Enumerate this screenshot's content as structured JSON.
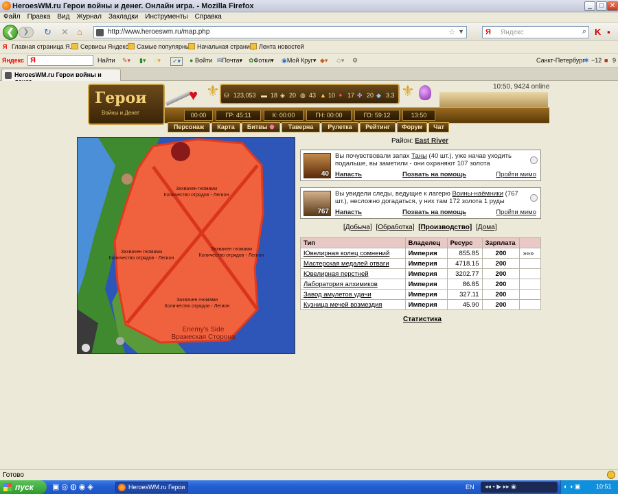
{
  "window": {
    "title": "HeroesWM.ru Герои войны и денег. Онлайн игра. - Mozilla Firefox",
    "min": "_",
    "max": "□",
    "close": "✕"
  },
  "menu": [
    "Файл",
    "Правка",
    "Вид",
    "Журнал",
    "Закладки",
    "Инструменты",
    "Справка"
  ],
  "nav": {
    "url": "http://www.heroeswm.ru/map.php",
    "search_logo": "Я",
    "search_placeholder": "Яндекс"
  },
  "bookmarks": [
    "Главная страница Я...",
    "Сервисы Яндекса",
    "Самые популярные",
    "Начальная страница",
    "Лента новостей"
  ],
  "yabar": {
    "logo": "Яндекс",
    "input": "Я",
    "find": "Найти",
    "login": "Войти",
    "mail": "Почта",
    "photos": "Фотки",
    "mycircle": "Мой Круг",
    "city": "Санкт-Петербург",
    "temp": "−12",
    "count": "9"
  },
  "tab": {
    "title": "HeroesWM.ru Герои войны и денег. ..."
  },
  "game": {
    "logo_top": "Герои",
    "logo_sub": "Войны и Денег",
    "online": "10:50, 9424 online",
    "resources": [
      {
        "icon": "gold-icon",
        "value": "123,053"
      },
      {
        "icon": "wood-icon",
        "value": "18"
      },
      {
        "icon": "ore-icon",
        "value": "20"
      },
      {
        "icon": "mercury-icon",
        "value": "43"
      },
      {
        "icon": "sulfur-icon",
        "value": "10"
      },
      {
        "icon": "crystal-icon",
        "value": "17"
      },
      {
        "icon": "gem-icon",
        "value": "20"
      },
      {
        "icon": "diamond-icon",
        "value": "3.3"
      }
    ],
    "timers": [
      "00:00",
      "ГР: 45:11",
      "К: 00:00",
      "ГН: 00:00",
      "ГО: 59:12",
      "13:50"
    ],
    "menu": [
      "Персонаж",
      "Карта",
      "Битвы",
      "Таверна",
      "Рулетка",
      "Рейтинг",
      "Форум",
      "Чат"
    ],
    "map_labels": [
      {
        "l1": "Захвачен гномами",
        "l2": "Количество отрядов - Легион"
      },
      {
        "l1": "Захвачен гномами",
        "l2": "Количество отрядов - Легион"
      },
      {
        "l1": "Захвачен гномами",
        "l2": "Количество отрядов - Легион"
      },
      {
        "l1": "Захвачен гномами",
        "l2": "Количество отрядов - Легион"
      }
    ],
    "map_side_en": "Enemy's Side",
    "map_side_ru": "Вражеская Сторона",
    "region_label": "Район:",
    "region_value": "East River",
    "events": [
      {
        "level": "40",
        "text_a": "Вы почувствовали запах ",
        "link": "Таны",
        "text_b": " (40 шт.), уже начав уходить подальше, вы заметили - они охраняют 107 золота",
        "attack": "Напасть",
        "help": "Позвать на помощь",
        "pass": "Пройти мимо"
      },
      {
        "level": "767",
        "text_a": "Вы увидели следы, ведущие к лагерю ",
        "link": "Воины-наёмники",
        "text_b": " (767 шт.), несложно догадаться, у них там 172 золота 1 руды",
        "attack": "Напасть",
        "help": "Позвать на помощь",
        "pass": "Пройти мимо"
      }
    ],
    "filters": [
      "[Добыча]",
      "[Обработка]",
      "[Производство]",
      "[Дома]"
    ],
    "table": {
      "headers": [
        "Тип",
        "Владелец",
        "Ресурс",
        "Зарплата",
        ""
      ],
      "rows": [
        {
          "name": "Ювелирная колец сомнений",
          "owner": "Империя",
          "res": "855.85",
          "pay": "200",
          "extra": "»»»"
        },
        {
          "name": "Мастерская медалей отваги",
          "owner": "Империя",
          "res": "4718.15",
          "pay": "200",
          "extra": ""
        },
        {
          "name": "Ювелирная перстней",
          "owner": "Империя",
          "res": "3202.77",
          "pay": "200",
          "extra": ""
        },
        {
          "name": "Лаборатория алхимиков",
          "owner": "Империя",
          "res": "86.85",
          "pay": "200",
          "extra": ""
        },
        {
          "name": "Завод амулетов удачи",
          "owner": "Империя",
          "res": "327.11",
          "pay": "200",
          "extra": ""
        },
        {
          "name": "Кузница мечей возмездия",
          "owner": "Империя",
          "res": "45.90",
          "pay": "200",
          "extra": ""
        }
      ]
    },
    "stats": "Статистика"
  },
  "status": "Готово",
  "taskbar": {
    "start": "пуск",
    "item": "HeroesWM.ru Герои ...",
    "lang": "EN",
    "clock": "10:51"
  }
}
